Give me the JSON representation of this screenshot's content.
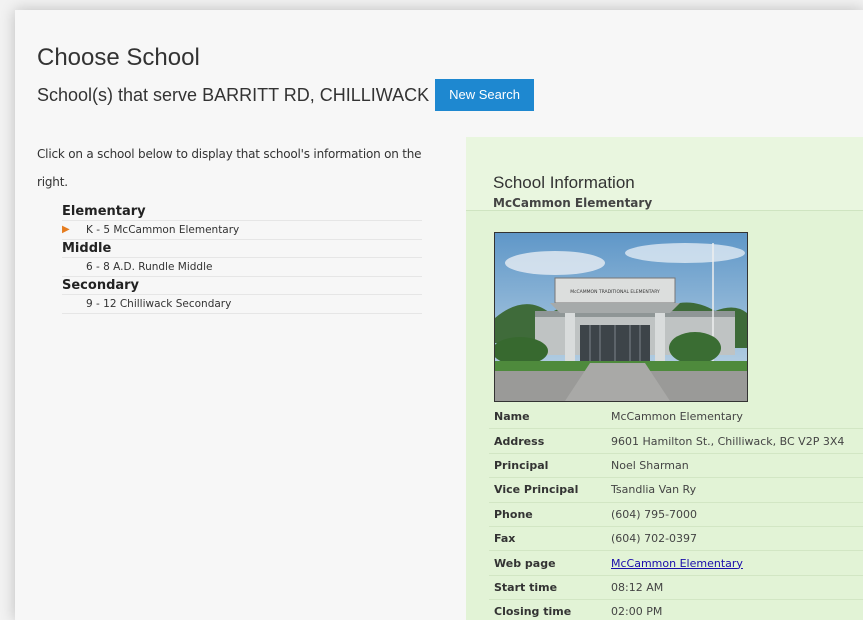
{
  "page": {
    "title": "Choose School",
    "subtitle": "School(s) that serve BARRITT RD, CHILLIWACK",
    "new_search_label": "New Search"
  },
  "instructions": "Click on a school below to display that school's information on the right.",
  "levels": [
    {
      "name": "Elementary",
      "school": "K - 5 McCammon Elementary",
      "selected": true
    },
    {
      "name": "Middle",
      "school": "6 - 8 A.D. Rundle Middle",
      "selected": false
    },
    {
      "name": "Secondary",
      "school": "9 - 12 Chilliwack Secondary",
      "selected": false
    }
  ],
  "info": {
    "heading": "School Information",
    "school_name": "McCammon Elementary",
    "photo_sign": "McCAMMON TRADITIONAL ELEMENTARY",
    "rows": [
      {
        "label": "Name",
        "value": "McCammon Elementary"
      },
      {
        "label": "Address",
        "value": "9601 Hamilton St., Chilliwack, BC V2P 3X4"
      },
      {
        "label": "Principal",
        "value": "Noel Sharman"
      },
      {
        "label": "Vice Principal",
        "value": "Tsandlia Van Ry"
      },
      {
        "label": "Phone",
        "value": "(604) 795-7000"
      },
      {
        "label": "Fax",
        "value": "(604) 702-0397"
      },
      {
        "label": "Web page",
        "value": "McCammon Elementary",
        "link": true
      },
      {
        "label": "Start time",
        "value": "08:12 AM"
      },
      {
        "label": "Closing time",
        "value": "02:00 PM"
      }
    ]
  },
  "colors": {
    "accent_button": "#1e88d0",
    "panel_bg": "#e2f3d6",
    "arrow": "#e57c1f",
    "link": "#1a0dab"
  }
}
